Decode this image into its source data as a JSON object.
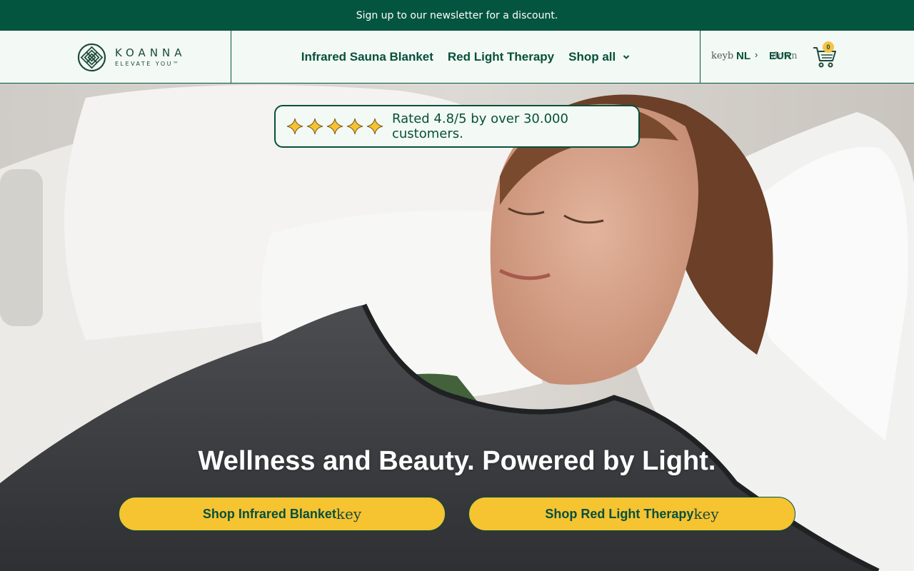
{
  "announcement": "Sign up to our newsletter for a discount.",
  "brand": {
    "name": "KOANNA",
    "tagline": "ELEVATE YOU™",
    "mark": "lattice-logo-icon",
    "color": "#03553f"
  },
  "nav": {
    "items": [
      {
        "label": "Infrared Sauna Blanket"
      },
      {
        "label": "Red Light Therapy"
      },
      {
        "label": "Shop all",
        "chevron": "chevron-down-icon"
      }
    ]
  },
  "tools": {
    "kb_stub": "keyb",
    "language": "NL",
    "currency": "EUR",
    "currency_ghost": "down",
    "cart_count": "0",
    "cart_icon": "shopping-cart-icon"
  },
  "hero": {
    "rating_text": "Rated 4.8/5 by over 30.000 customers.",
    "stars": 5,
    "headline": "Wellness and Beauty. Powered by Light.",
    "cta_primary": "Shop Infrared Blanket",
    "cta_secondary": "Shop Red Light Therapy",
    "cta_suffix": "key",
    "accent": "#f6c331"
  }
}
